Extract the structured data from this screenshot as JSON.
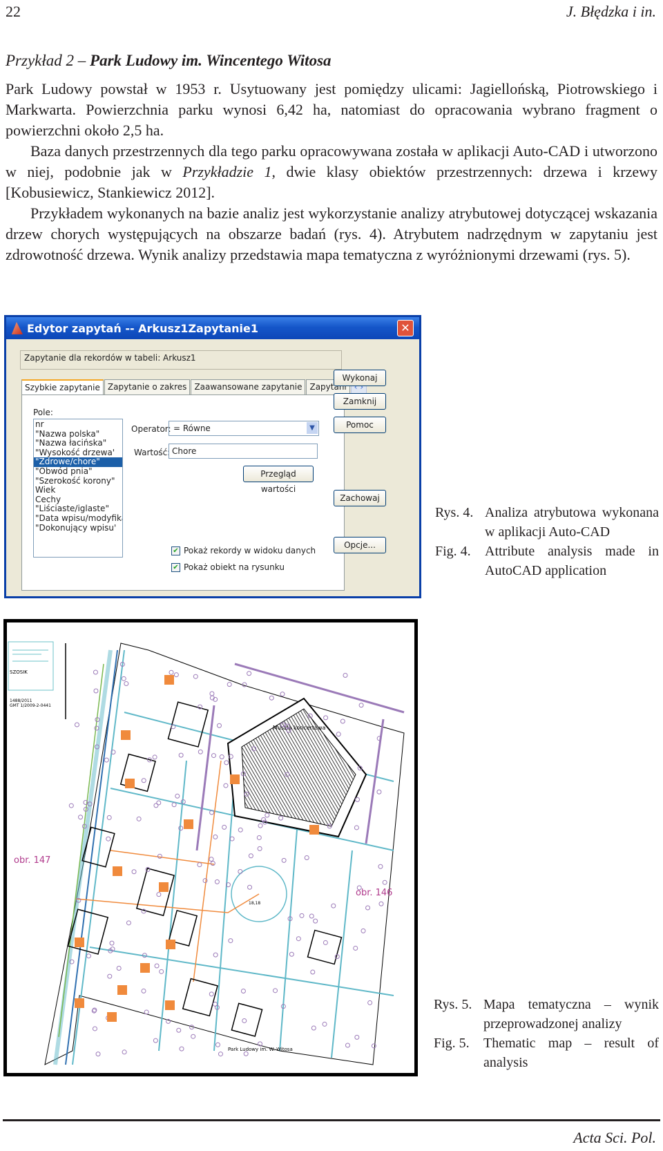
{
  "header": {
    "page_number": "22",
    "authors": "J. Błędzka i in."
  },
  "section": {
    "prefix": "Przykład 2 – ",
    "title": "Park Ludowy im. Wincentego Witosa"
  },
  "paragraphs": [
    "Park Ludowy powstał w 1953 r. Usytuowany jest pomiędzy ulicami: Jagiellońską, Piotrowskiego i Markwarta. Powierzchnia parku wynosi 6,42 ha, natomiast do opracowania wybrano fragment o powierzchni około 2,5 ha.",
    "Baza danych przestrzennych dla tego parku opracowywana została w aplikacji Auto-CAD i utworzono w niej, podobnie jak w ",
    "Przykładzie 1",
    ", dwie klasy obiektów przestrzennych: drzewa i krzewy [Kobusiewicz, Stankiewicz 2012].",
    "Przykładem wykonanych na bazie analiz jest wykorzystanie analizy atrybutowej dotyczącej wskazania drzew chorych występujących na obszarze badań (rys. 4). Atrybutem nadrzędnym w zapytaniu jest zdrowotność drzewa. Wynik analizy przedstawia mapa tematyczna z wyróżnionymi drzewami (rys. 5)."
  ],
  "dialog": {
    "title": "Edytor zapytań -- Arkusz1Zapytanie1",
    "close_glyph": "✕",
    "query_header": "Zapytanie dla rekordów w tabeli:  Arkusz1",
    "tabs": [
      "Szybkie zapytanie",
      "Zapytanie o zakres",
      "Zaawansowane zapytanie",
      "Zapytani"
    ],
    "tab_arrows": "‹ ›",
    "field_label": "Pole:",
    "fields": [
      "nr",
      "\"Nazwa polska\"",
      "\"Nazwa łacińska\"",
      "\"Wysokość drzewa'",
      "\"Zdrowe/chore\"",
      "\"Obwód pnia\"",
      "\"Szerokość korony\"",
      "Wiek",
      "Cechy",
      "\"Liściaste/iglaste\"",
      "\"Data wpisu/modyfikacji",
      "\"Dokonujący wpisu'"
    ],
    "selected_field_index": 4,
    "operator_label": "Operator:",
    "operator_value": "=   Równe",
    "value_label": "Wartość:",
    "value": "Chore",
    "browse_button": "Przegląd wartości",
    "checkbox_records": "Pokaż rekordy w widoku danych",
    "checkbox_object": "Pokaż obiekt na rysunku",
    "checkbox_records_checked": true,
    "checkbox_object_checked": true,
    "buttons": {
      "execute": "Wykonaj",
      "close": "Zamknij",
      "help": "Pomoc",
      "save": "Zachowaj",
      "options": "Opcje..."
    }
  },
  "captions": {
    "fig4": {
      "pl_label": "Rys. 4.",
      "pl_text": "Analiza atrybutowa wykonana w aplikacji Auto-CAD",
      "en_label": "Fig. 4.",
      "en_text": "Attribute analysis made in AutoCAD application"
    },
    "fig5": {
      "pl_label": "Rys. 5.",
      "pl_text": "Mapa tematyczna – wynik przeprowadzonej analizy",
      "en_label": "Fig. 5.",
      "en_text": "Thematic map – result of analysis"
    }
  },
  "map": {
    "labels": {
      "parcel_left": "obr. 147",
      "parcel_right": "obr. 146",
      "shell": "Muszla koncertowa",
      "park": "Park Ludowy im. W. Witosa",
      "fountain": "18,18"
    },
    "legend_text": [
      "SZOSIK",
      "1488/2011",
      "GMT 1/2009-2-0441"
    ],
    "colors": {
      "highlight_trees": "#f08a3c",
      "paths": "#5fb8c8",
      "trees": "#9b7ab8",
      "outline": "#000000"
    }
  },
  "footer": {
    "journal": "Acta Sci. Pol."
  }
}
